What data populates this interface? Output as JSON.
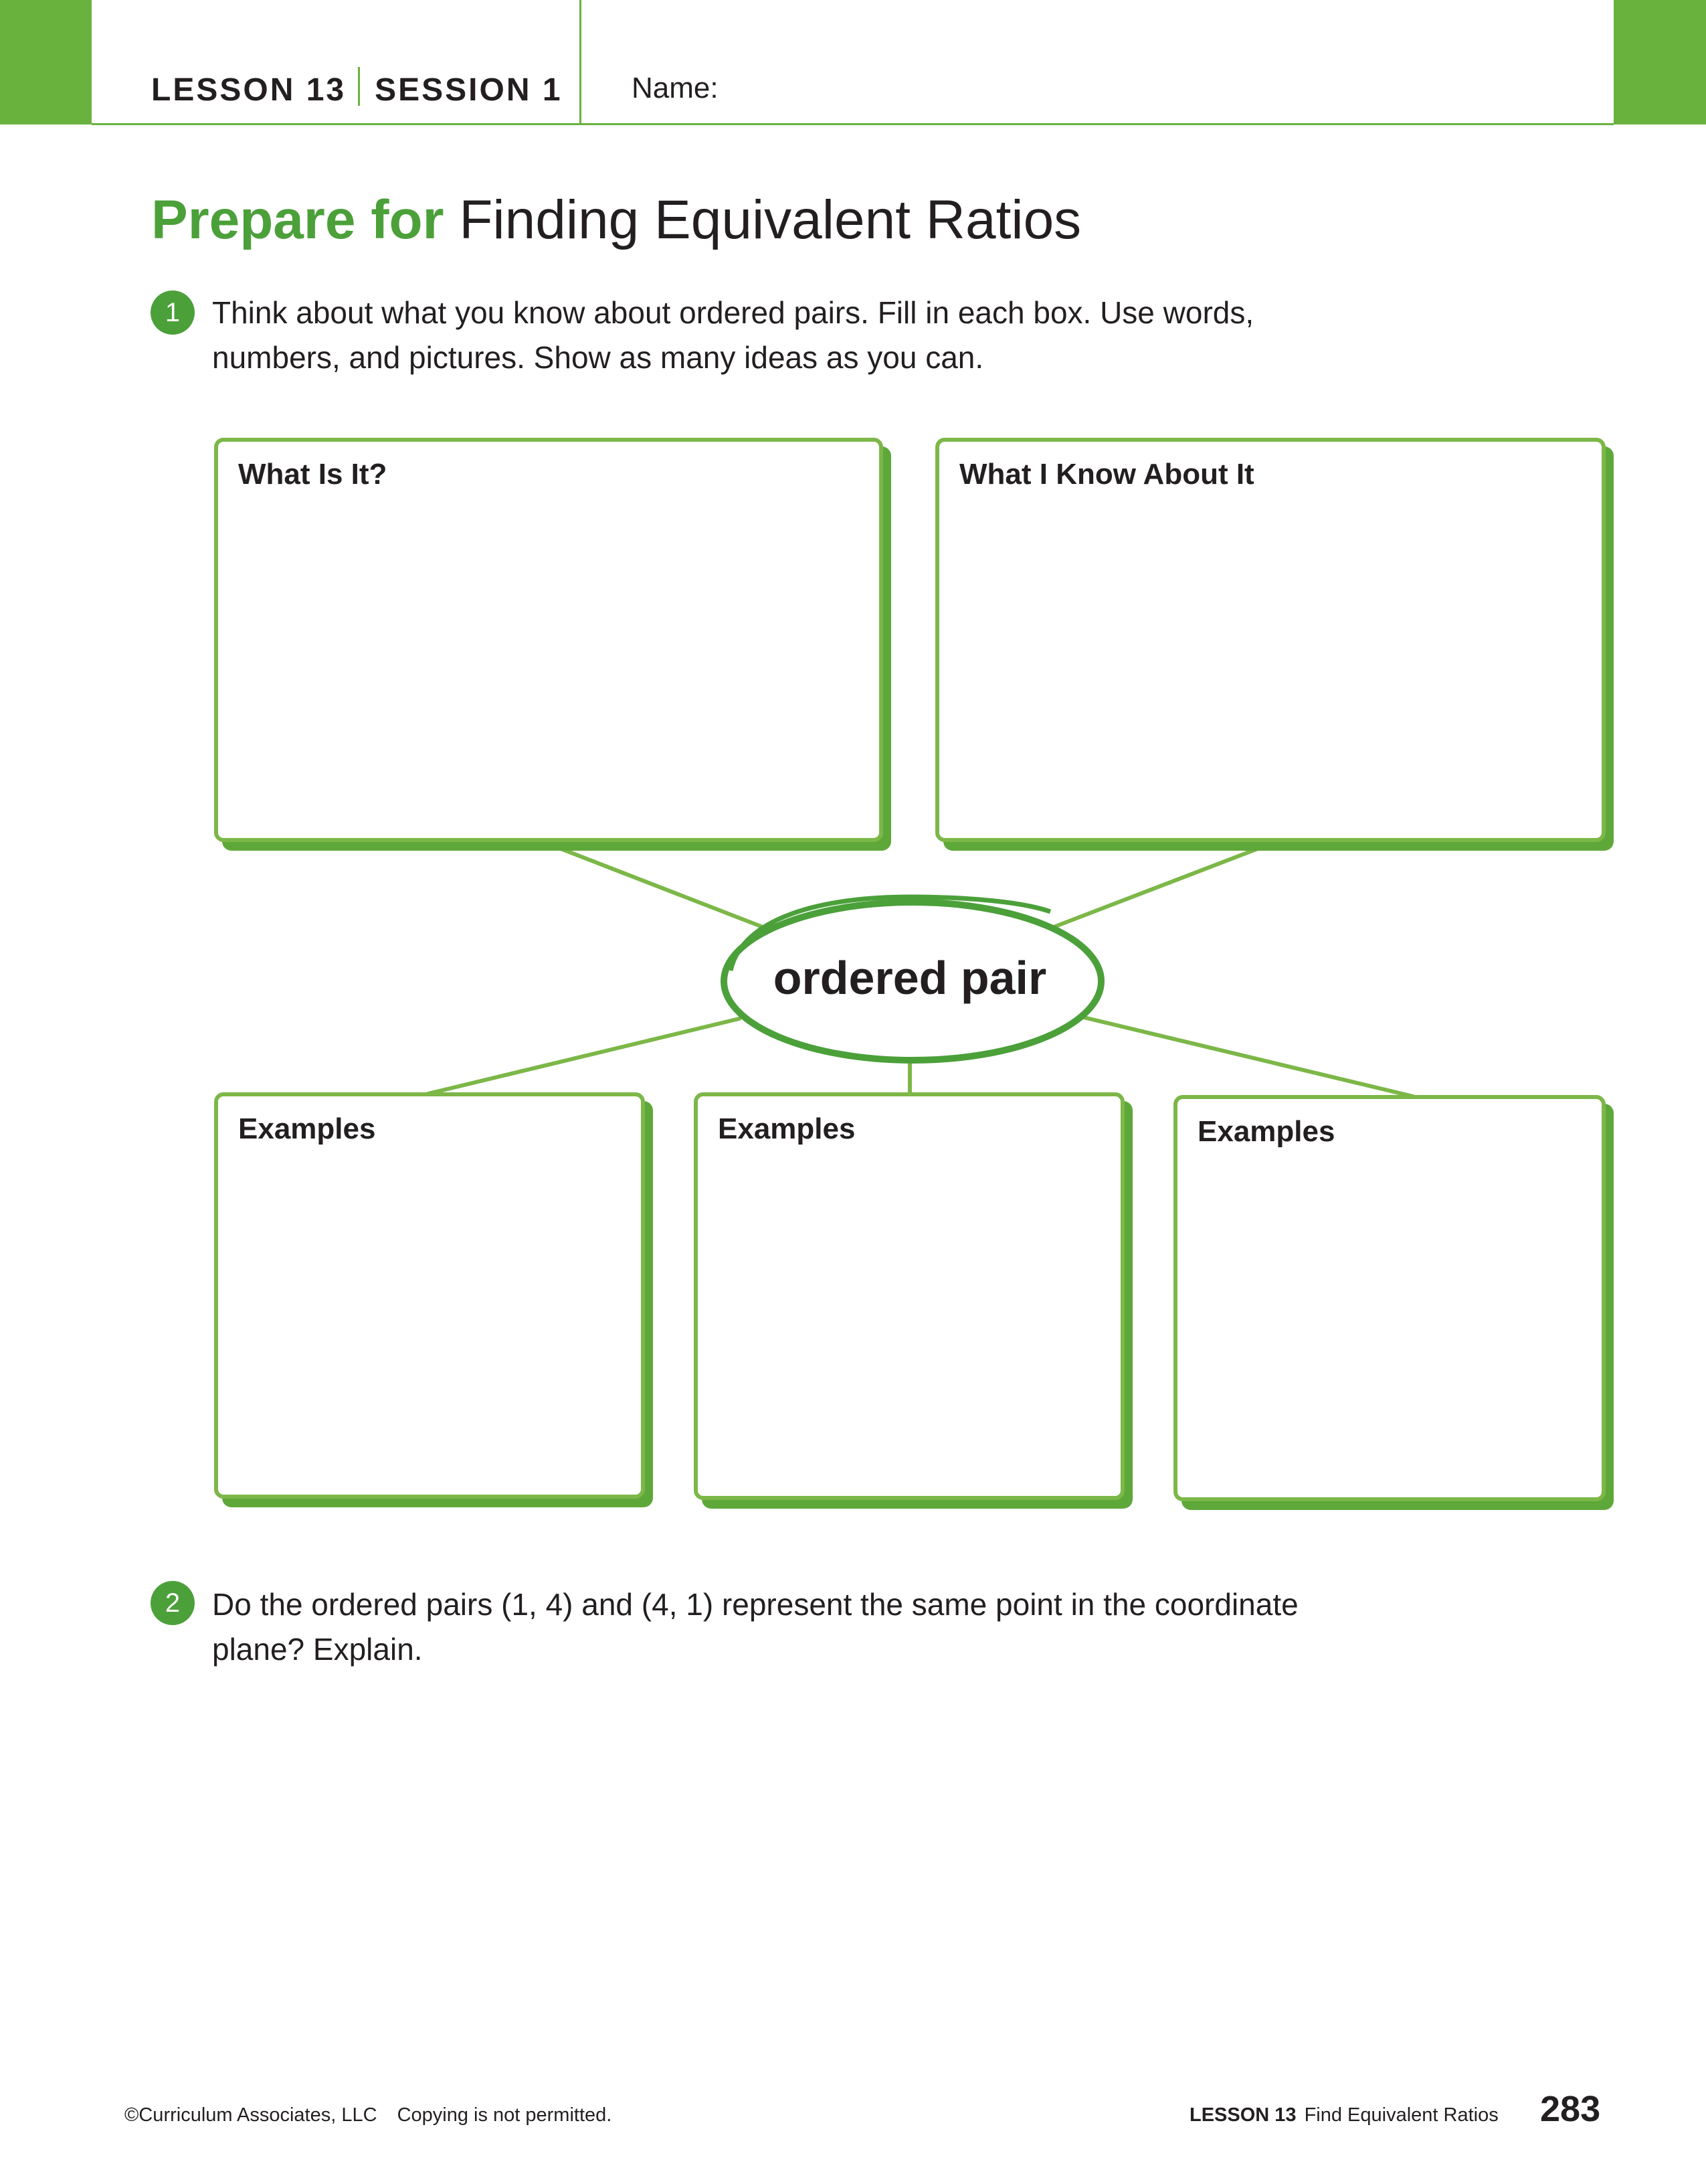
{
  "header": {
    "lesson": "LESSON 13",
    "session": "SESSION 1",
    "name_label": "Name:"
  },
  "title": {
    "strong": "Prepare for",
    "rest": "Finding Equivalent Ratios"
  },
  "question1": {
    "number": "1",
    "lines": [
      "Think about what you know about ordered pairs. Fill in each box. Use words,",
      "numbers, and pictures. Show as many ideas as you can."
    ]
  },
  "organizer": {
    "center": "ordered pair",
    "top_boxes": [
      "What Is It?",
      "What I Know About It"
    ],
    "bottom_boxes": [
      "Examples",
      "Examples",
      "Examples"
    ]
  },
  "question2": {
    "number": "2",
    "lines": [
      "Do the ordered pairs (1, 4) and (4, 1) represent the same point in the coordinate",
      "plane? Explain."
    ]
  },
  "footer": {
    "copyright": "©Curriculum Associates, LLC",
    "notice": "Copying is not permitted.",
    "lesson": "LESSON 13",
    "lesson_title": "Find Equivalent Ratios",
    "page_number": "283"
  },
  "colors": {
    "accent": "#4ba03a",
    "border": "#7cb748",
    "text": "#231f20"
  }
}
